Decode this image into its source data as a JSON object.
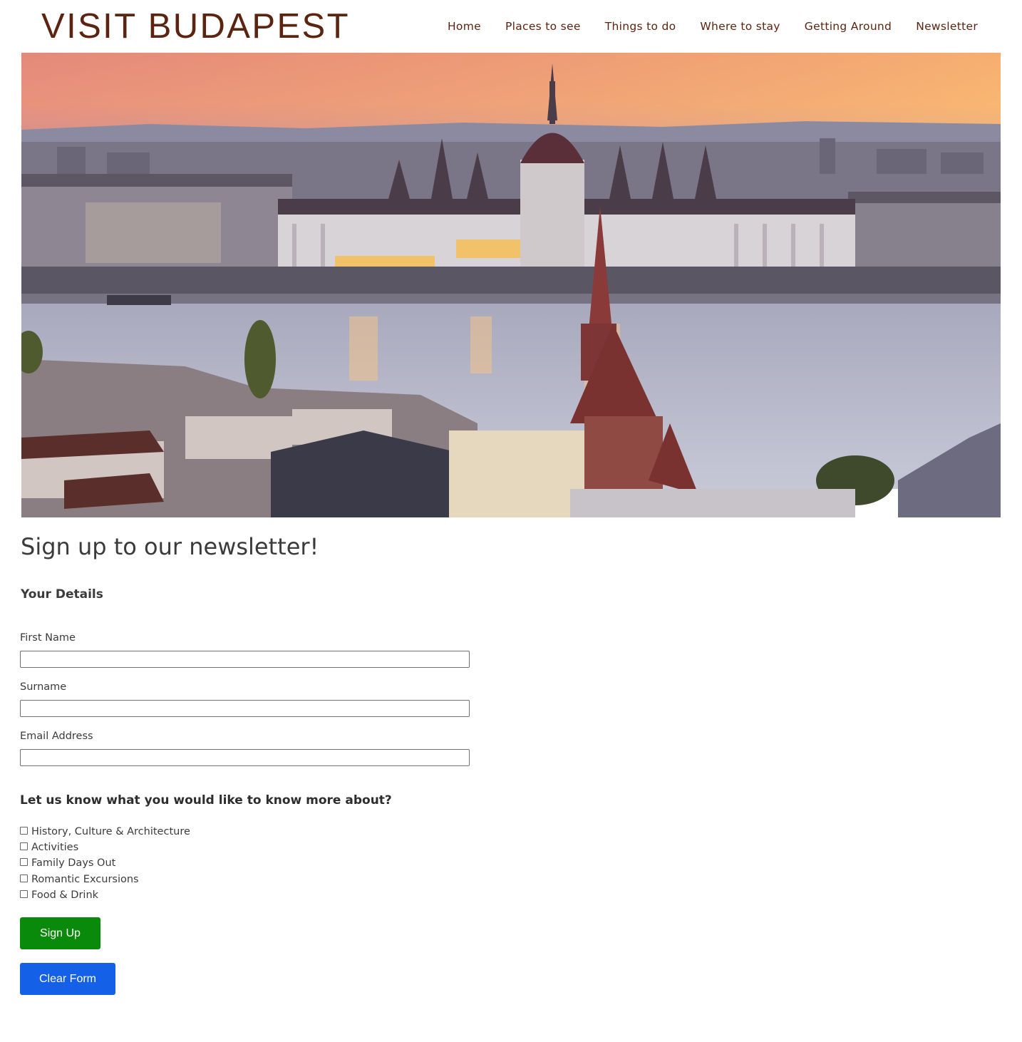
{
  "site": {
    "logo": "VISIT BUDAPEST"
  },
  "nav": {
    "items": [
      {
        "label": "Home",
        "name": "nav-home"
      },
      {
        "label": "Places to see",
        "name": "nav-places-to-see"
      },
      {
        "label": "Things to do",
        "name": "nav-things-to-do"
      },
      {
        "label": "Where to stay",
        "name": "nav-where-to-stay"
      },
      {
        "label": "Getting Around",
        "name": "nav-getting-around"
      },
      {
        "label": "Newsletter",
        "name": "nav-newsletter"
      }
    ]
  },
  "hero": {
    "image": "budapest-parliament-danube-sunset"
  },
  "page": {
    "title": "Sign up to our newsletter!",
    "details_heading": "Your Details"
  },
  "form": {
    "first_name_label": "First Name",
    "first_name_value": "",
    "surname_label": "Surname",
    "surname_value": "",
    "email_label": "Email Address",
    "email_value": "",
    "interests_heading": "Let us know what you would like to know more about?",
    "interests": [
      {
        "label": "History, Culture & Architecture",
        "checked": false
      },
      {
        "label": "Activities",
        "checked": false
      },
      {
        "label": "Family Days Out",
        "checked": false
      },
      {
        "label": "Romantic Excursions",
        "checked": false
      },
      {
        "label": "Food & Drink",
        "checked": false
      }
    ],
    "signup_label": "Sign Up",
    "clear_label": "Clear Form"
  },
  "colors": {
    "brand": "#5c2410",
    "signup_button": "#0a8a0a",
    "clear_button": "#1460e6"
  }
}
